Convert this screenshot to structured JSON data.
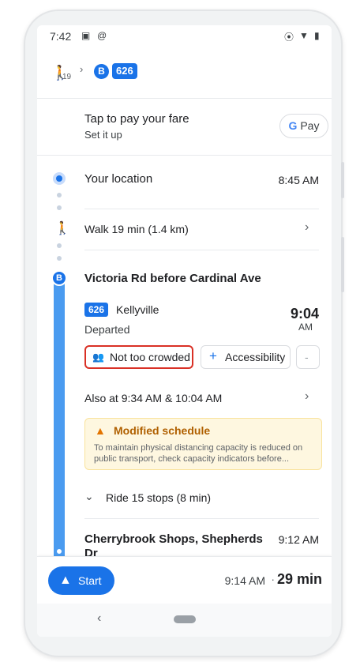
{
  "status_bar": {
    "time": "7:42",
    "icons": [
      "gallery-icon",
      "at-icon",
      "location-icon",
      "wifi-icon",
      "battery-icon"
    ]
  },
  "route": {
    "walk_minutes": "19",
    "stop_letter": "B",
    "bus_number": "626"
  },
  "payment": {
    "title": "Tap to pay your fare",
    "subtitle": "Set it up",
    "button_label": "Pay",
    "button_g": "G"
  },
  "timeline": {
    "origin": {
      "label": "Your location",
      "time": "8:45 AM"
    },
    "walk": {
      "label": "Walk 19 min (1.4 km)"
    },
    "stop": {
      "letter": "B",
      "name": "Victoria Rd before Cardinal Ave",
      "bus_number": "626",
      "destination": "Kellyville",
      "status": "Departed",
      "time": "9:04",
      "ampm": "AM"
    },
    "chips": {
      "crowd": "Not too crowded",
      "accessibility": "Accessibility",
      "more": "-"
    },
    "also_at": "Also at 9:34 AM & 10:04 AM",
    "alert": {
      "title": "Modified schedule",
      "message": "To maintain physical distancing capacity is reduced on public transport, check capacity indicators before..."
    },
    "ride": "Ride 15 stops (8 min)",
    "destination": {
      "name": "Cherrybrook Shops, Shepherds Dr",
      "time": "9:12 AM"
    }
  },
  "bottom_bar": {
    "start_label": "Start",
    "arrival_time": "9:14 AM",
    "separator": "·",
    "duration": "29 min"
  },
  "colors": {
    "accent": "#1a73e8",
    "highlight_border": "#d93025",
    "alert_bg": "#fef7e0",
    "alert_title": "#b06000"
  }
}
